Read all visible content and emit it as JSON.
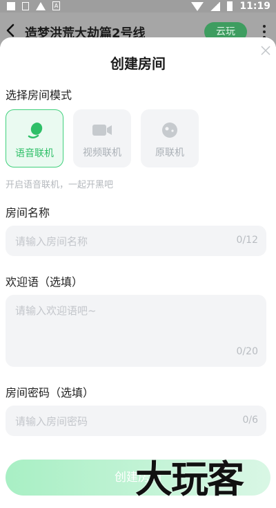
{
  "status_bar": {
    "time": "11:19",
    "a_label": "A"
  },
  "header": {
    "title": "造梦洪荒大劫篇2号线",
    "cloud_button": "云玩"
  },
  "sheet": {
    "title": "创建房间",
    "mode_section_label": "选择房间模式",
    "modes": [
      {
        "label": "语音联机",
        "icon": "microphone-icon",
        "active": true
      },
      {
        "label": "视频联机",
        "icon": "video-camera-icon",
        "active": false
      },
      {
        "label": "原联机",
        "icon": "gamepad-icon",
        "active": false
      }
    ],
    "mode_hint": "开启语音联机，一起开黑吧",
    "room_name": {
      "label": "房间名称",
      "placeholder": "请输入房间名称",
      "counter": "0/12"
    },
    "welcome": {
      "label": "欢迎语（选填）",
      "placeholder": "请输入欢迎语吧~",
      "counter": "0/20"
    },
    "password": {
      "label": "房间密码（选填）",
      "placeholder": "请输入房间密码",
      "counter": "0/6"
    },
    "submit_label": "创建房间"
  },
  "watermark": "大玩客",
  "colors": {
    "accent": "#2fbf68",
    "header_bg": "#a6a6a6",
    "field_bg": "#f3f4f6"
  }
}
